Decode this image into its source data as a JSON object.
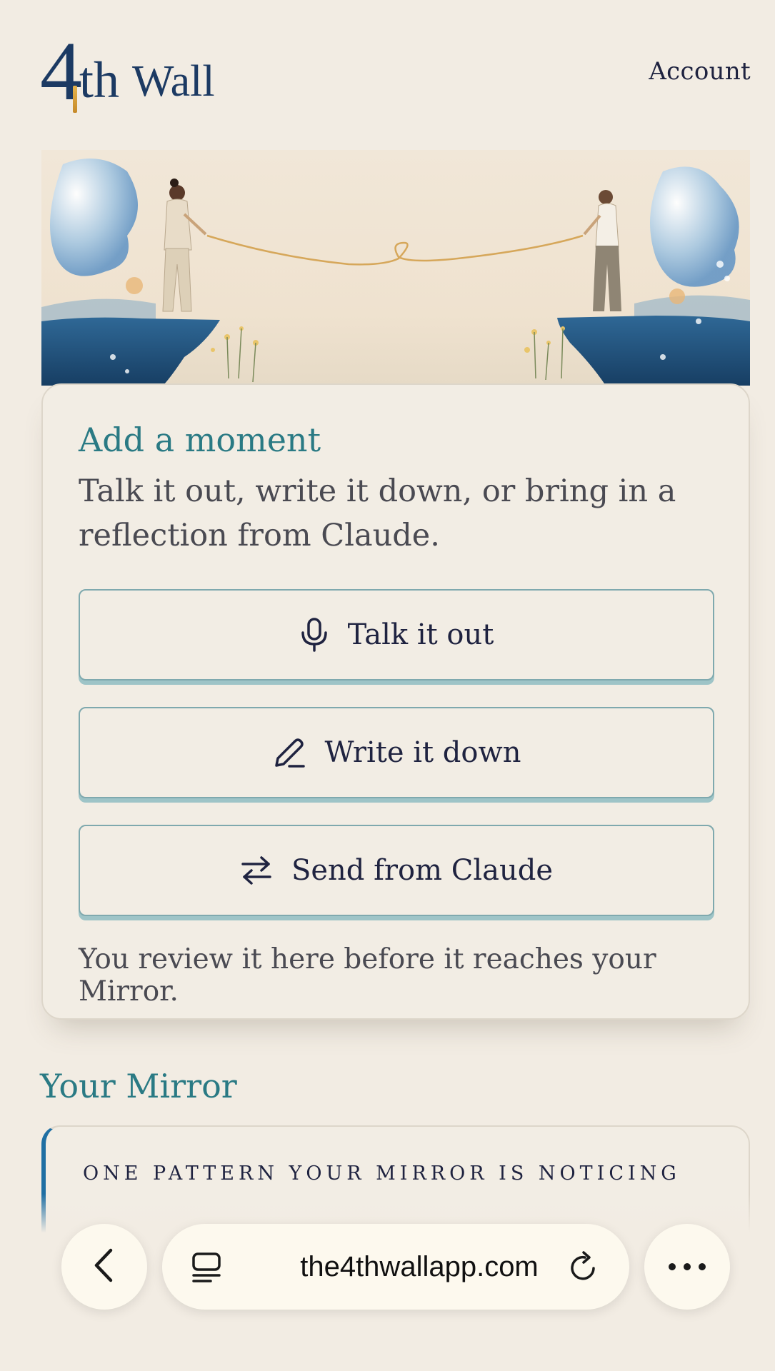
{
  "header": {
    "logo": {
      "four": "4",
      "th": "th",
      "wall": "Wall"
    },
    "account_label": "Account"
  },
  "hero": {
    "image": "two-women-holding-string-across-cliffs-illustration"
  },
  "add_moment": {
    "title": "Add a moment",
    "subtitle": "Talk it out, write it down, or bring in a reflection from Claude.",
    "buttons": [
      {
        "label": "Talk it out",
        "icon": "microphone-icon"
      },
      {
        "label": "Write it down",
        "icon": "pencil-icon"
      },
      {
        "label": "Send from Claude",
        "icon": "transfer-arrows-icon"
      }
    ],
    "note": "You review it here before it reaches your Mirror."
  },
  "mirror": {
    "title": "Your Mirror",
    "pattern_label": "ONE PATTERN YOUR MIRROR IS NOTICING"
  },
  "browser": {
    "url": "the4thwallapp.com",
    "back_icon": "chevron-left-icon",
    "tabs_icon": "tabs-icon",
    "reload_icon": "reload-icon",
    "more_icon": "more-dots-icon"
  },
  "colors": {
    "background": "#f2ece3",
    "accent_teal": "#2a7a84",
    "navy": "#1c3a63",
    "button_border": "#7fa9ae",
    "mirror_accent": "#1f6fa3"
  }
}
